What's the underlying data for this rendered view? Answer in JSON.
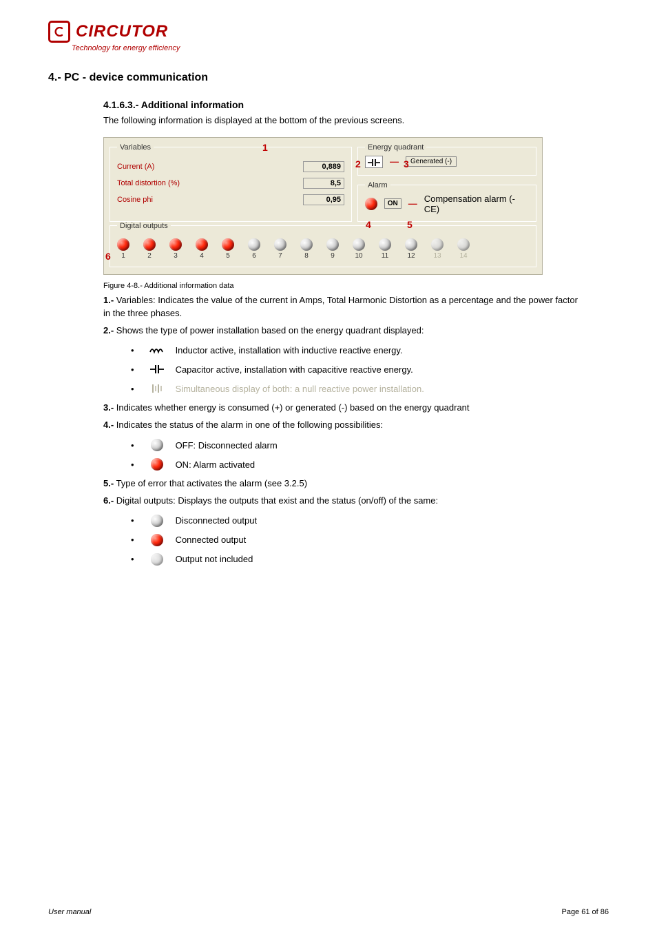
{
  "brand": {
    "name": "CIRCUTOR",
    "tagline": "Technology for energy efficiency"
  },
  "section_title": "4.- PC - device communication",
  "intro": {
    "heading": "4.1.6.3.- Additional information",
    "text": "The following information is displayed at the bottom of the previous screens."
  },
  "screenshot": {
    "variables": {
      "legend": "Variables",
      "rows": [
        {
          "label": "Current (A)",
          "value": "0,889"
        },
        {
          "label": "Total distortion (%)",
          "value": "8,5"
        },
        {
          "label": "Cosine phi",
          "value": "0,95"
        }
      ]
    },
    "quadrant": {
      "legend": "Energy quadrant",
      "tag": "Generated (-)"
    },
    "alarm": {
      "legend": "Alarm",
      "state": "ON",
      "tag": "Compensation alarm (-CE)"
    },
    "outputs": {
      "legend": "Digital outputs",
      "items": [
        {
          "n": "1",
          "on": true,
          "enabled": true
        },
        {
          "n": "2",
          "on": true,
          "enabled": true
        },
        {
          "n": "3",
          "on": true,
          "enabled": true
        },
        {
          "n": "4",
          "on": true,
          "enabled": true
        },
        {
          "n": "5",
          "on": true,
          "enabled": true
        },
        {
          "n": "6",
          "on": false,
          "enabled": true
        },
        {
          "n": "7",
          "on": false,
          "enabled": true
        },
        {
          "n": "8",
          "on": false,
          "enabled": true
        },
        {
          "n": "9",
          "on": false,
          "enabled": true
        },
        {
          "n": "10",
          "on": false,
          "enabled": true
        },
        {
          "n": "11",
          "on": false,
          "enabled": true
        },
        {
          "n": "12",
          "on": false,
          "enabled": true
        },
        {
          "n": "13",
          "on": false,
          "enabled": false
        },
        {
          "n": "14",
          "on": false,
          "enabled": false
        }
      ]
    },
    "annotations": {
      "a1": "1",
      "a2": "2",
      "a3": "3",
      "a4": "4",
      "a5": "5",
      "a6": "6"
    }
  },
  "caption": "Figure 4-8.- Additional information data",
  "legend1": {
    "n": "1.-",
    "text": "Variables: Indicates the value of the current in Amps, Total Harmonic Distortion as a percentage and the power factor in the three phases."
  },
  "legend2": {
    "n": "2.-",
    "text": "Shows the type of power installation based on the energy quadrant displayed:",
    "items": [
      {
        "icon": "inductor",
        "text": "Inductor active, installation with inductive reactive energy."
      },
      {
        "icon": "capacitor",
        "text": "Capacitor active, installation with capacitive reactive energy."
      },
      {
        "icon": "battery",
        "text": "Simultaneous display of both: a null reactive power installation.",
        "dim": true
      }
    ]
  },
  "legend3": {
    "n": "3.-",
    "text": "Indicates whether energy is consumed (+) or generated (-) based on the energy quadrant"
  },
  "legend4": {
    "n": "4.-",
    "text": "Indicates the status of the alarm in one of the following possibilities:",
    "items": [
      {
        "led": "grey",
        "text": "OFF: Disconnected alarm"
      },
      {
        "led": "red",
        "text": "ON: Alarm activated"
      }
    ]
  },
  "legend5": {
    "n": "5.-",
    "text": "Type of error that activates the alarm (see 3.2.5)"
  },
  "legend6": {
    "n": "6.-",
    "text": "Digital outputs: Displays the outputs that exist and the status (on/off) of the same:",
    "items": [
      {
        "led": "grey",
        "text": "Disconnected output"
      },
      {
        "led": "red",
        "text": "Connected output"
      },
      {
        "led": "dim",
        "text": "Output not included"
      }
    ]
  },
  "footer": {
    "left": "User manual",
    "right": "Page 61 of 86"
  }
}
